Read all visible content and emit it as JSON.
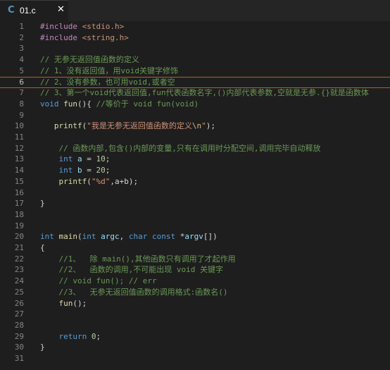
{
  "tab": {
    "icon": "C",
    "filename": "01.c",
    "close": "✕",
    "icon_name": "c-language-icon"
  },
  "colors": {
    "background": "#1e1e1e",
    "keyword": "#569cd6",
    "comment": "#6a9955",
    "string": "#ce9178",
    "number": "#b5cea8",
    "function": "#dcdcaa",
    "active_line_border": "#b8601a"
  },
  "editor": {
    "active_line": "6",
    "lines": [
      {
        "n": "1",
        "tokens": [
          [
            "pp",
            "#include "
          ],
          [
            "str",
            "<stdio.h>"
          ]
        ]
      },
      {
        "n": "2",
        "tokens": [
          [
            "pp",
            "#include "
          ],
          [
            "str",
            "<string.h>"
          ]
        ]
      },
      {
        "n": "3",
        "tokens": []
      },
      {
        "n": "4",
        "tokens": [
          [
            "cm",
            "// 无参无返回值函数的定义"
          ]
        ]
      },
      {
        "n": "5",
        "tokens": [
          [
            "cm",
            "// 1、没有返回值，用void关键字修饰"
          ]
        ]
      },
      {
        "n": "6",
        "tokens": [
          [
            "cm",
            "// 2、没有参数，也可用void,或者空"
          ]
        ]
      },
      {
        "n": "7",
        "tokens": [
          [
            "cm",
            "// 3、第一个void代表返回值,fun代表函数名字,()内部代表参数,空就是无参.{}就是函数体"
          ]
        ]
      },
      {
        "n": "8",
        "tokens": [
          [
            "kw",
            "void "
          ],
          [
            "fn",
            "fun"
          ],
          [
            "",
            "(){ "
          ],
          [
            "cm",
            "//等价于 void fun(void)"
          ]
        ]
      },
      {
        "n": "9",
        "tokens": []
      },
      {
        "n": "10",
        "tokens": [
          [
            "",
            "   "
          ],
          [
            "fn",
            "printf"
          ],
          [
            "",
            "("
          ],
          [
            "str",
            "\"我是无参无返回值函数的定义"
          ],
          [
            "esc",
            "\\n"
          ],
          [
            "str",
            "\""
          ],
          [
            "",
            ");"
          ]
        ]
      },
      {
        "n": "11",
        "tokens": []
      },
      {
        "n": "12",
        "tokens": [
          [
            "",
            "    "
          ],
          [
            "cm",
            "// 函数内部,包含()内部的变量,只有在调用时分配空间,调用完毕自动释放"
          ]
        ]
      },
      {
        "n": "13",
        "tokens": [
          [
            "",
            "    "
          ],
          [
            "kw",
            "int "
          ],
          [
            "id",
            "a"
          ],
          [
            "",
            " = "
          ],
          [
            "num",
            "10"
          ],
          [
            "",
            ";"
          ]
        ]
      },
      {
        "n": "14",
        "tokens": [
          [
            "",
            "    "
          ],
          [
            "kw",
            "int "
          ],
          [
            "id",
            "b"
          ],
          [
            "",
            " = "
          ],
          [
            "num",
            "20"
          ],
          [
            "",
            ";"
          ]
        ]
      },
      {
        "n": "15",
        "tokens": [
          [
            "",
            "    "
          ],
          [
            "fn",
            "printf"
          ],
          [
            "",
            "("
          ],
          [
            "str",
            "\"%d\""
          ],
          [
            "",
            ",a+b);"
          ]
        ]
      },
      {
        "n": "16",
        "tokens": []
      },
      {
        "n": "17",
        "tokens": [
          [
            "",
            "}"
          ]
        ]
      },
      {
        "n": "18",
        "tokens": []
      },
      {
        "n": "19",
        "tokens": []
      },
      {
        "n": "20",
        "tokens": [
          [
            "kw",
            "int "
          ],
          [
            "fn",
            "main"
          ],
          [
            "",
            "("
          ],
          [
            "kw",
            "int "
          ],
          [
            "id",
            "argc"
          ],
          [
            ",",
            ", "
          ],
          [
            "kw",
            "char const "
          ],
          [
            "",
            "*"
          ],
          [
            "id",
            "argv"
          ],
          [
            "",
            "[])"
          ]
        ]
      },
      {
        "n": "21",
        "tokens": [
          [
            "",
            "{"
          ]
        ]
      },
      {
        "n": "22",
        "tokens": [
          [
            "",
            "    "
          ],
          [
            "cm",
            "//1、  除 main(),其他函数只有调用了才起作用"
          ]
        ]
      },
      {
        "n": "23",
        "tokens": [
          [
            "",
            "    "
          ],
          [
            "cm",
            "//2、  函数的调用,不可能出现 void 关键字"
          ]
        ]
      },
      {
        "n": "24",
        "tokens": [
          [
            "",
            "    "
          ],
          [
            "cm",
            "// void fun(); // err"
          ]
        ]
      },
      {
        "n": "25",
        "tokens": [
          [
            "",
            "    "
          ],
          [
            "cm",
            "//3、  无参无返回值函数的调用格式:函数名()"
          ]
        ]
      },
      {
        "n": "26",
        "tokens": [
          [
            "",
            "    "
          ],
          [
            "fn",
            "fun"
          ],
          [
            "",
            "();"
          ]
        ]
      },
      {
        "n": "27",
        "tokens": []
      },
      {
        "n": "28",
        "tokens": []
      },
      {
        "n": "29",
        "tokens": [
          [
            "",
            "    "
          ],
          [
            "kw",
            "return "
          ],
          [
            "num",
            "0"
          ],
          [
            "",
            ";"
          ]
        ]
      },
      {
        "n": "30",
        "tokens": [
          [
            "",
            "}"
          ]
        ]
      },
      {
        "n": "31",
        "tokens": []
      }
    ]
  }
}
